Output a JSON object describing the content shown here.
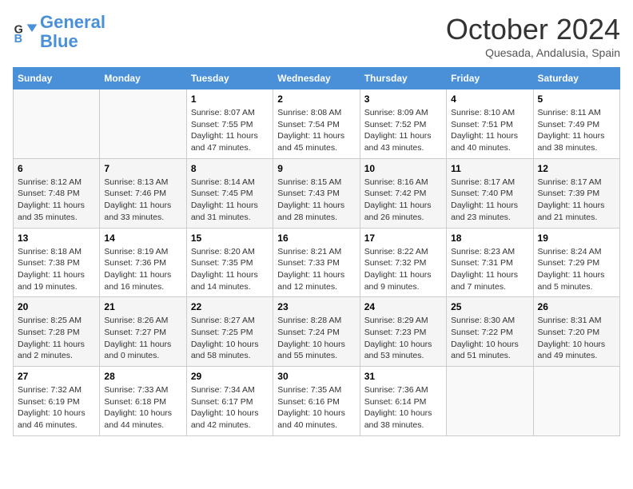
{
  "header": {
    "logo_general": "General",
    "logo_blue": "Blue",
    "month_title": "October 2024",
    "location": "Quesada, Andalusia, Spain"
  },
  "days_of_week": [
    "Sunday",
    "Monday",
    "Tuesday",
    "Wednesday",
    "Thursday",
    "Friday",
    "Saturday"
  ],
  "weeks": [
    [
      {
        "day": "",
        "info": ""
      },
      {
        "day": "",
        "info": ""
      },
      {
        "day": "1",
        "sunrise": "Sunrise: 8:07 AM",
        "sunset": "Sunset: 7:55 PM",
        "daylight": "Daylight: 11 hours and 47 minutes."
      },
      {
        "day": "2",
        "sunrise": "Sunrise: 8:08 AM",
        "sunset": "Sunset: 7:54 PM",
        "daylight": "Daylight: 11 hours and 45 minutes."
      },
      {
        "day": "3",
        "sunrise": "Sunrise: 8:09 AM",
        "sunset": "Sunset: 7:52 PM",
        "daylight": "Daylight: 11 hours and 43 minutes."
      },
      {
        "day": "4",
        "sunrise": "Sunrise: 8:10 AM",
        "sunset": "Sunset: 7:51 PM",
        "daylight": "Daylight: 11 hours and 40 minutes."
      },
      {
        "day": "5",
        "sunrise": "Sunrise: 8:11 AM",
        "sunset": "Sunset: 7:49 PM",
        "daylight": "Daylight: 11 hours and 38 minutes."
      }
    ],
    [
      {
        "day": "6",
        "sunrise": "Sunrise: 8:12 AM",
        "sunset": "Sunset: 7:48 PM",
        "daylight": "Daylight: 11 hours and 35 minutes."
      },
      {
        "day": "7",
        "sunrise": "Sunrise: 8:13 AM",
        "sunset": "Sunset: 7:46 PM",
        "daylight": "Daylight: 11 hours and 33 minutes."
      },
      {
        "day": "8",
        "sunrise": "Sunrise: 8:14 AM",
        "sunset": "Sunset: 7:45 PM",
        "daylight": "Daylight: 11 hours and 31 minutes."
      },
      {
        "day": "9",
        "sunrise": "Sunrise: 8:15 AM",
        "sunset": "Sunset: 7:43 PM",
        "daylight": "Daylight: 11 hours and 28 minutes."
      },
      {
        "day": "10",
        "sunrise": "Sunrise: 8:16 AM",
        "sunset": "Sunset: 7:42 PM",
        "daylight": "Daylight: 11 hours and 26 minutes."
      },
      {
        "day": "11",
        "sunrise": "Sunrise: 8:17 AM",
        "sunset": "Sunset: 7:40 PM",
        "daylight": "Daylight: 11 hours and 23 minutes."
      },
      {
        "day": "12",
        "sunrise": "Sunrise: 8:17 AM",
        "sunset": "Sunset: 7:39 PM",
        "daylight": "Daylight: 11 hours and 21 minutes."
      }
    ],
    [
      {
        "day": "13",
        "sunrise": "Sunrise: 8:18 AM",
        "sunset": "Sunset: 7:38 PM",
        "daylight": "Daylight: 11 hours and 19 minutes."
      },
      {
        "day": "14",
        "sunrise": "Sunrise: 8:19 AM",
        "sunset": "Sunset: 7:36 PM",
        "daylight": "Daylight: 11 hours and 16 minutes."
      },
      {
        "day": "15",
        "sunrise": "Sunrise: 8:20 AM",
        "sunset": "Sunset: 7:35 PM",
        "daylight": "Daylight: 11 hours and 14 minutes."
      },
      {
        "day": "16",
        "sunrise": "Sunrise: 8:21 AM",
        "sunset": "Sunset: 7:33 PM",
        "daylight": "Daylight: 11 hours and 12 minutes."
      },
      {
        "day": "17",
        "sunrise": "Sunrise: 8:22 AM",
        "sunset": "Sunset: 7:32 PM",
        "daylight": "Daylight: 11 hours and 9 minutes."
      },
      {
        "day": "18",
        "sunrise": "Sunrise: 8:23 AM",
        "sunset": "Sunset: 7:31 PM",
        "daylight": "Daylight: 11 hours and 7 minutes."
      },
      {
        "day": "19",
        "sunrise": "Sunrise: 8:24 AM",
        "sunset": "Sunset: 7:29 PM",
        "daylight": "Daylight: 11 hours and 5 minutes."
      }
    ],
    [
      {
        "day": "20",
        "sunrise": "Sunrise: 8:25 AM",
        "sunset": "Sunset: 7:28 PM",
        "daylight": "Daylight: 11 hours and 2 minutes."
      },
      {
        "day": "21",
        "sunrise": "Sunrise: 8:26 AM",
        "sunset": "Sunset: 7:27 PM",
        "daylight": "Daylight: 11 hours and 0 minutes."
      },
      {
        "day": "22",
        "sunrise": "Sunrise: 8:27 AM",
        "sunset": "Sunset: 7:25 PM",
        "daylight": "Daylight: 10 hours and 58 minutes."
      },
      {
        "day": "23",
        "sunrise": "Sunrise: 8:28 AM",
        "sunset": "Sunset: 7:24 PM",
        "daylight": "Daylight: 10 hours and 55 minutes."
      },
      {
        "day": "24",
        "sunrise": "Sunrise: 8:29 AM",
        "sunset": "Sunset: 7:23 PM",
        "daylight": "Daylight: 10 hours and 53 minutes."
      },
      {
        "day": "25",
        "sunrise": "Sunrise: 8:30 AM",
        "sunset": "Sunset: 7:22 PM",
        "daylight": "Daylight: 10 hours and 51 minutes."
      },
      {
        "day": "26",
        "sunrise": "Sunrise: 8:31 AM",
        "sunset": "Sunset: 7:20 PM",
        "daylight": "Daylight: 10 hours and 49 minutes."
      }
    ],
    [
      {
        "day": "27",
        "sunrise": "Sunrise: 7:32 AM",
        "sunset": "Sunset: 6:19 PM",
        "daylight": "Daylight: 10 hours and 46 minutes."
      },
      {
        "day": "28",
        "sunrise": "Sunrise: 7:33 AM",
        "sunset": "Sunset: 6:18 PM",
        "daylight": "Daylight: 10 hours and 44 minutes."
      },
      {
        "day": "29",
        "sunrise": "Sunrise: 7:34 AM",
        "sunset": "Sunset: 6:17 PM",
        "daylight": "Daylight: 10 hours and 42 minutes."
      },
      {
        "day": "30",
        "sunrise": "Sunrise: 7:35 AM",
        "sunset": "Sunset: 6:16 PM",
        "daylight": "Daylight: 10 hours and 40 minutes."
      },
      {
        "day": "31",
        "sunrise": "Sunrise: 7:36 AM",
        "sunset": "Sunset: 6:14 PM",
        "daylight": "Daylight: 10 hours and 38 minutes."
      },
      {
        "day": "",
        "info": ""
      },
      {
        "day": "",
        "info": ""
      }
    ]
  ]
}
